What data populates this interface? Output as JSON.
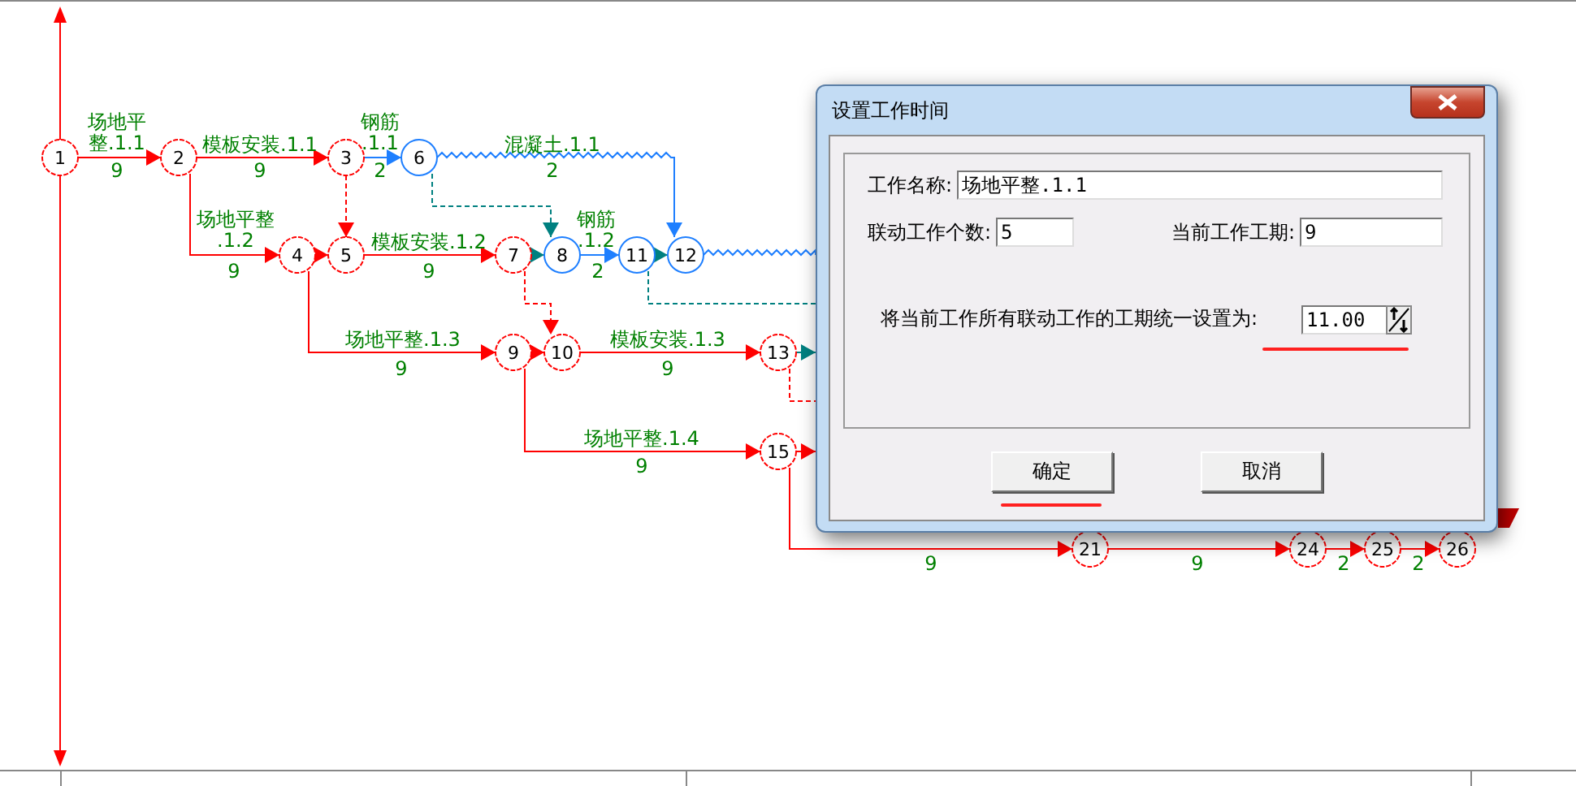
{
  "network": {
    "nodes": [
      {
        "label": "1",
        "critical": true
      },
      {
        "label": "2",
        "critical": true
      },
      {
        "label": "3",
        "critical": true
      },
      {
        "label": "6",
        "critical": false
      },
      {
        "label": "4",
        "critical": true
      },
      {
        "label": "5",
        "critical": true
      },
      {
        "label": "7",
        "critical": true
      },
      {
        "label": "8",
        "critical": false
      },
      {
        "label": "11",
        "critical": false
      },
      {
        "label": "12",
        "critical": false
      },
      {
        "label": "9",
        "critical": true
      },
      {
        "label": "10",
        "critical": true
      },
      {
        "label": "13",
        "critical": true
      },
      {
        "label": "15",
        "critical": true
      },
      {
        "label": "21",
        "critical": true
      },
      {
        "label": "24",
        "critical": true
      },
      {
        "label": "25",
        "critical": true
      },
      {
        "label": "26",
        "critical": true
      }
    ],
    "activities": [
      {
        "kind": "work",
        "critical": true,
        "name_lines": [
          "场地平",
          "整.1.1"
        ],
        "duration": "9"
      },
      {
        "kind": "work",
        "critical": true,
        "name_lines": [
          "模板安装.1.1"
        ],
        "duration": "9"
      },
      {
        "kind": "work",
        "critical": false,
        "name_lines": [
          "钢筋",
          ".1.1"
        ],
        "duration": "2"
      },
      {
        "kind": "float",
        "critical": false,
        "name_lines": [
          "混凝土.1.1"
        ],
        "duration": "2"
      },
      {
        "kind": "work",
        "critical": true,
        "name_lines": [
          "场地平整",
          ".1.2"
        ],
        "duration": "9"
      },
      {
        "kind": "dummy",
        "critical": true
      },
      {
        "kind": "work",
        "critical": true
      },
      {
        "kind": "work",
        "critical": true,
        "name_lines": [
          "模板安装.1.2"
        ],
        "duration": "9"
      },
      {
        "kind": "dummy",
        "critical": false
      },
      {
        "kind": "dummy",
        "critical": false
      },
      {
        "kind": "work",
        "critical": false,
        "name_lines": [
          "钢筋",
          ".1.2"
        ],
        "duration": "2"
      },
      {
        "kind": "dummy",
        "critical": false
      },
      {
        "kind": "float",
        "critical": false
      },
      {
        "kind": "dummy",
        "critical": false
      },
      {
        "kind": "work",
        "critical": true,
        "name_lines": [
          "场地平整.1.3"
        ],
        "duration": "9"
      },
      {
        "kind": "dummy",
        "critical": true
      },
      {
        "kind": "work",
        "critical": true
      },
      {
        "kind": "work",
        "critical": true,
        "name_lines": [
          "模板安装.1.3"
        ],
        "duration": "9"
      },
      {
        "kind": "dummy",
        "critical": false
      },
      {
        "kind": "dummy",
        "critical": true
      },
      {
        "kind": "work",
        "critical": true,
        "name_lines": [
          "场地平整.1.4"
        ],
        "duration": "9"
      },
      {
        "kind": "work",
        "critical": true
      },
      {
        "kind": "work",
        "critical": true,
        "duration": "9"
      },
      {
        "kind": "work",
        "critical": true,
        "duration": "9"
      },
      {
        "kind": "work",
        "critical": true,
        "duration": "2"
      },
      {
        "kind": "work",
        "critical": true,
        "duration": "2"
      }
    ]
  },
  "dialog": {
    "title": "设置工作时间",
    "fields": [
      {
        "label": "工作名称:",
        "value": "场地平整.1.1",
        "kind": "wide"
      },
      {
        "label": "联动工作个数:",
        "value": "5",
        "kind": "short"
      },
      {
        "label": "当前工作工期:",
        "value": "9",
        "kind": "short"
      }
    ],
    "spin_field": {
      "label": "将当前工作所有联动工作的工期统一设置为:",
      "value": "11.00",
      "underlined": true
    },
    "buttons": [
      {
        "label": "确定",
        "underlined": true
      },
      {
        "label": "取消",
        "underlined": false
      }
    ]
  }
}
